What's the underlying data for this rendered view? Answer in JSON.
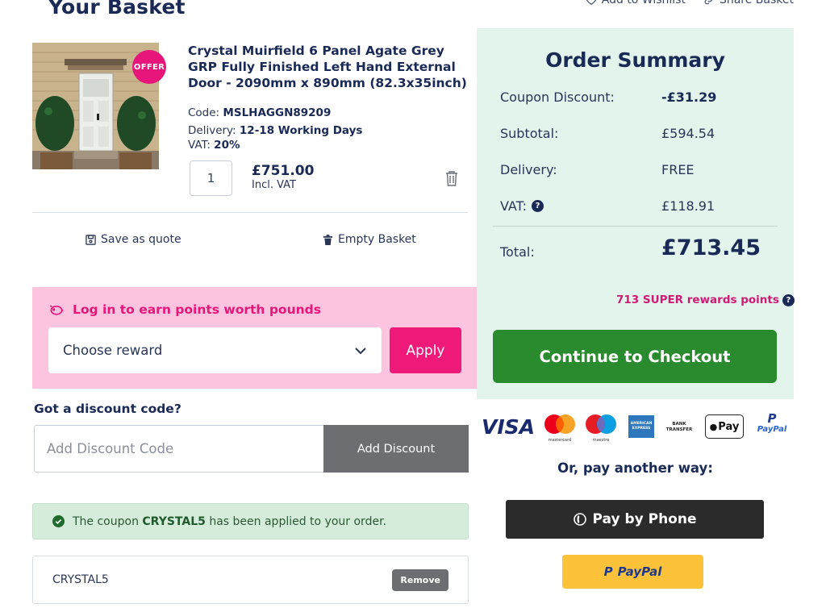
{
  "header": {
    "title": "Your Basket",
    "add_to_wishlist": "Add to Wishlist",
    "share_basket": "Share Basket"
  },
  "product": {
    "offer_badge": "OFFER",
    "title": "Crystal Muirfield 6 Panel Agate Grey GRP Fully Finished Left Hand External Door - 2090mm x 890mm (82.3x35inch)",
    "code_label": "Code:",
    "code": "MSLHAGGN89209",
    "delivery_label": "Delivery:",
    "delivery": "12-18 Working Days",
    "vat_label": "VAT:",
    "vat": "20%",
    "quantity": "1",
    "price": "£751.00",
    "price_sub": "Incl. VAT"
  },
  "actions": {
    "save_quote": "Save as quote",
    "empty_basket": "Empty Basket"
  },
  "rewards": {
    "heading": "Log in to earn points worth pounds",
    "select_value": "Choose reward",
    "apply": "Apply"
  },
  "discount": {
    "label": "Got a discount code?",
    "placeholder": "Add Discount Code",
    "button": "Add Discount",
    "msg_pre": "The coupon",
    "msg_code": "CRYSTAL5",
    "msg_post": "has been applied to your order.",
    "applied_code": "CRYSTAL5",
    "remove": "Remove"
  },
  "summary": {
    "title": "Order Summary",
    "coupon_label": "Coupon Discount:",
    "coupon_value": "-£31.29",
    "subtotal_label": "Subtotal:",
    "subtotal_value": "£594.54",
    "delivery_label": "Delivery:",
    "delivery_value": "FREE",
    "vat_label": "VAT:",
    "vat_value": "£118.91",
    "total_label": "Total:",
    "total_value": "£713.45",
    "points": "713 SUPER rewards points",
    "checkout": "Continue to Checkout"
  },
  "payment": {
    "visa": "VISA",
    "mastercard": "mastercard",
    "maestro": "maestro",
    "amex": "AMERICAN EXPRESS",
    "bank_transfer": "BANK TRANSFER",
    "apple_pay": "Pay",
    "paypal_logo": "PayPal",
    "other_way": "Or, pay another way:",
    "pay_by_phone": "Pay by Phone",
    "paypal_button": "PayPal"
  },
  "colors": {
    "navy": "#1a2a56",
    "pink": "#e8157a",
    "green": "#2a8a2e",
    "summary_bg": "#e3f4ec",
    "rewards_bg": "#fdc4df"
  }
}
